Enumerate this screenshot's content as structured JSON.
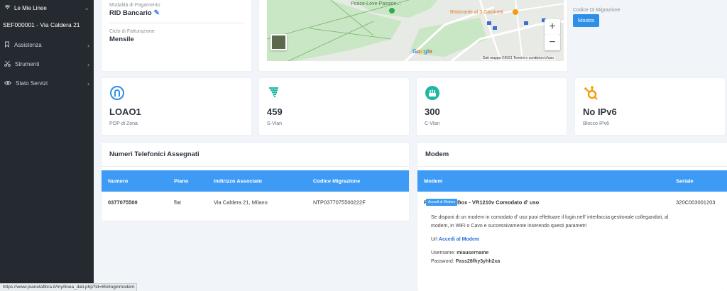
{
  "sidebar": {
    "header": "Le Mie Linee",
    "line": "SEF000001 - Via Caldera 21",
    "items": [
      {
        "label": "Assistenza",
        "icon": "bookmark-icon"
      },
      {
        "label": "Strumenti",
        "icon": "scissors-icon"
      },
      {
        "label": "Stato Servizi",
        "icon": "eye-icon"
      }
    ]
  },
  "info": {
    "payment_label": "Modalità di Pagamento",
    "payment_value": "RID Bancario",
    "billing_label": "Ciclo di Fatturazione",
    "billing_value": "Mensile"
  },
  "map": {
    "place1": "Peace-Love-Passion...",
    "place2": "Ristorante ai 3 Camineti",
    "google": "Google",
    "credit": "Dati mappa ©2021    Termini e condizioni d'uso",
    "zoom_in": "+",
    "zoom_out": "−"
  },
  "migration": {
    "label": "Codice Di Migrazione",
    "button": "Mostra"
  },
  "stats": [
    {
      "value": "LOAO1",
      "label": "POP di Zona",
      "icon": "location-icon",
      "color": "#2d8fe8"
    },
    {
      "value": "459",
      "label": "S-Vlan",
      "icon": "network-icon",
      "color": "#1fb7a3"
    },
    {
      "value": "300",
      "label": "C-Vlan",
      "icon": "router-icon",
      "color": "#1fb7a3"
    },
    {
      "value": "No IPv6",
      "label": "Blocco IPv6",
      "icon": "hubspot-icon",
      "color": "#f59e0b"
    }
  ],
  "numbers": {
    "title": "Numeri Telefonici Assegnati",
    "headers": [
      "Numero",
      "Piano",
      "Indirizzo Associato",
      "Codice Migrazione"
    ],
    "rows": [
      [
        "0377075500",
        "flat",
        "Via Caldera 21, Milano",
        "NTP0377075500222F"
      ]
    ]
  },
  "modem": {
    "title": "Modem",
    "headers": [
      "Modem",
      "Seriale"
    ],
    "name": "PianetaFibra Box - VR1210v Comodato d' uso",
    "badge": "Accedi al Modem",
    "serial": "320C003001203",
    "desc": "Se disponi di un modem in comodato d' uso puoi effettuare il login nell' interfaccia gestionale collegandoti, al modem, in WiFi o Cavo e successivamente inserendo questi parametri",
    "url_label": "Url",
    "url_link": "Accedi al Modem",
    "username_label": "Username:",
    "username": "miausername",
    "password_label": "Password:",
    "password": "Pass28fhy3yhh2xa"
  },
  "statusbar": "https://www.pianetafibra.it/my/linea_dati.php?id=65#loginmodem"
}
